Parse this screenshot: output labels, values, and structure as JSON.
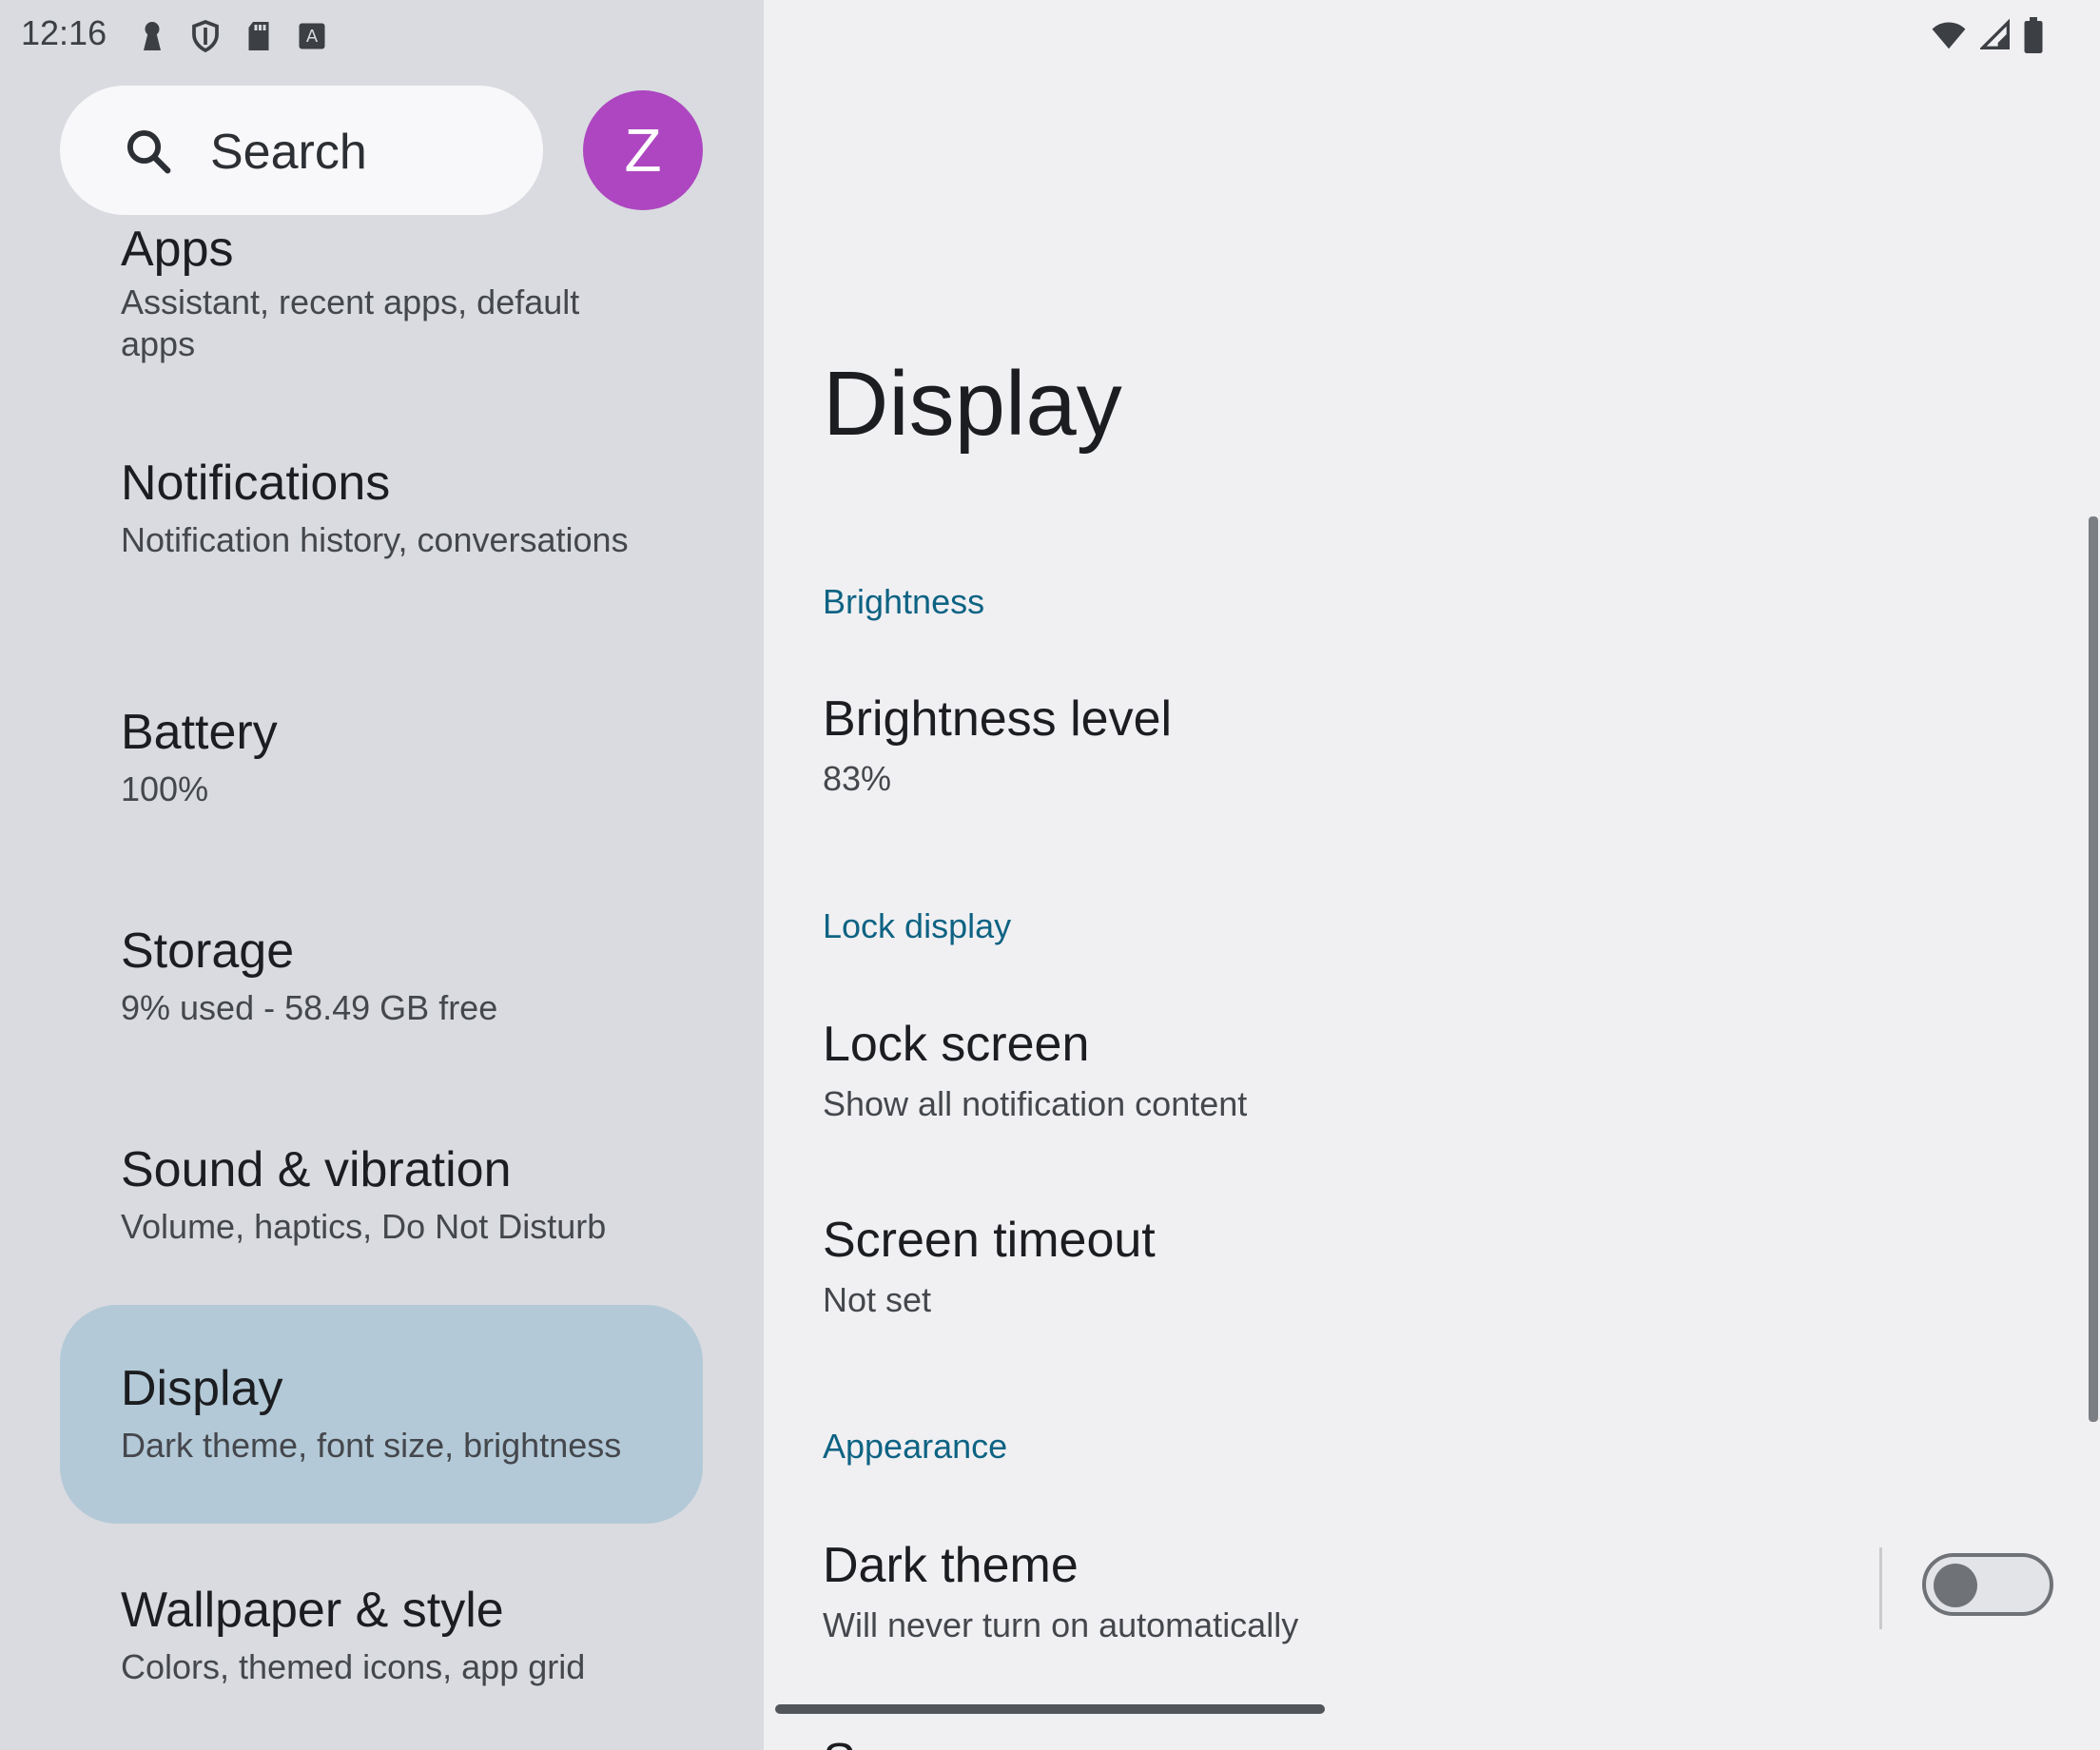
{
  "status_bar": {
    "time": "12:16",
    "left_icons": [
      "keyhole-icon",
      "shield-icon",
      "sd-card-icon",
      "keyboard-a-icon"
    ],
    "right_icons": [
      "wifi-icon",
      "signal-icon",
      "battery-icon"
    ]
  },
  "search": {
    "label": "Search",
    "icon": "search-icon"
  },
  "avatar": {
    "letter": "Z",
    "color": "#ad46c0"
  },
  "sidebar": {
    "items": [
      {
        "title": "Apps",
        "subtitle": "Assistant, recent apps, default apps"
      },
      {
        "title": "Notifications",
        "subtitle": "Notification history, conversations"
      },
      {
        "title": "Battery",
        "subtitle": "100%"
      },
      {
        "title": "Storage",
        "subtitle": "9% used - 58.49 GB free"
      },
      {
        "title": "Sound & vibration",
        "subtitle": "Volume, haptics, Do Not Disturb"
      },
      {
        "title": "Display",
        "subtitle": "Dark theme, font size, brightness",
        "selected": true
      },
      {
        "title": "Wallpaper & style",
        "subtitle": "Colors, themed icons, app grid"
      }
    ]
  },
  "main": {
    "title": "Display",
    "sections": [
      {
        "header": "Brightness",
        "items": [
          {
            "title": "Brightness level",
            "subtitle": "83%"
          }
        ]
      },
      {
        "header": "Lock display",
        "items": [
          {
            "title": "Lock screen",
            "subtitle": "Show all notification content"
          },
          {
            "title": "Screen timeout",
            "subtitle": "Not set"
          }
        ]
      },
      {
        "header": "Appearance",
        "items": [
          {
            "title": "Dark theme",
            "subtitle": "Will never turn on automatically",
            "toggle": false
          }
        ]
      }
    ],
    "clipped_next_item": "S"
  },
  "colors": {
    "accent": "#0e6383",
    "selected_bg": "#b3c9d7",
    "left_bg": "#d9dbe0",
    "right_bg": "#f0f0f3"
  }
}
